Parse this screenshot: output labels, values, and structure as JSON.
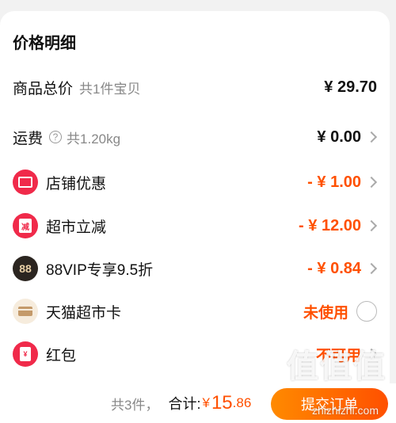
{
  "panel": {
    "title": "价格明细"
  },
  "rows": {
    "goods_total": {
      "label": "商品总价",
      "sub": "共1件宝贝",
      "value": "¥ 29.70"
    },
    "shipping": {
      "label": "运费",
      "sub": "共1.20kg",
      "value": "¥ 0.00",
      "icon": "question-icon"
    },
    "shop_discount": {
      "label": "店铺优惠",
      "value": "- ¥ 1.00",
      "icon": "coupon-icon"
    },
    "market_reduce": {
      "label": "超市立减",
      "value": "- ¥ 12.00",
      "icon": "reduce-icon",
      "icon_text": "减"
    },
    "vip": {
      "label": "88VIP专享9.5折",
      "value": "- ¥ 0.84",
      "icon": "88vip-icon",
      "icon_text": "88"
    },
    "market_card": {
      "label": "天猫超市卡",
      "value": "未使用",
      "icon": "card-icon"
    },
    "red_packet": {
      "label": "红包",
      "value": "不可用",
      "icon": "red-packet-icon",
      "icon_text": "¥"
    }
  },
  "footer": {
    "count": "共3件，",
    "total_label": "合计:",
    "currency": "¥",
    "total_int": "15",
    "total_dec": ".86",
    "submit_label": "提交订单"
  },
  "watermark": {
    "text": "值值值",
    "site": "zhizhizhi.com"
  },
  "colors": {
    "accent": "#ff5000",
    "badge_red": "#f02a4a"
  }
}
